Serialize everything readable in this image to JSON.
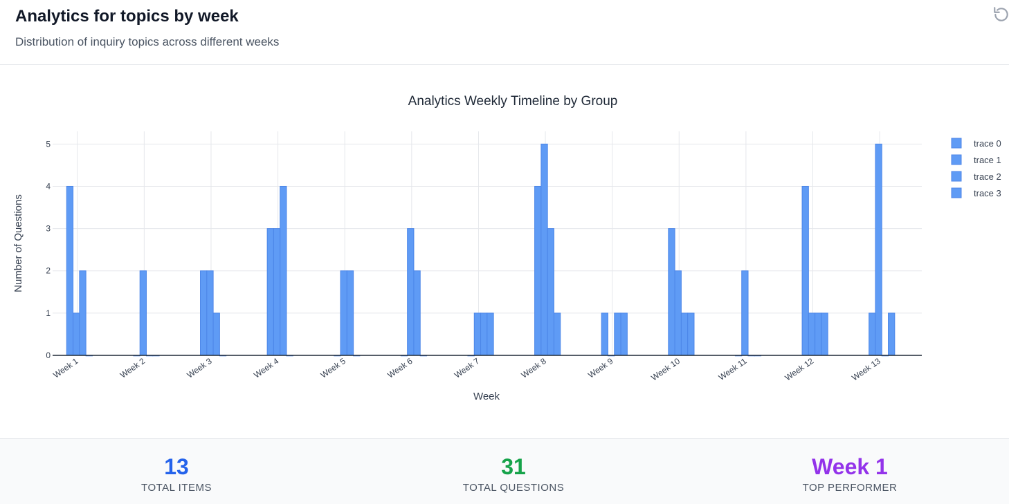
{
  "header": {
    "title": "Analytics for topics by week",
    "subtitle": "Distribution of inquiry topics across different weeks"
  },
  "chart_data": {
    "type": "bar",
    "title": "Analytics Weekly Timeline by Group",
    "xlabel": "Week",
    "ylabel": "Number of Questions",
    "categories": [
      "Week 1",
      "Week 2",
      "Week 3",
      "Week 4",
      "Week 5",
      "Week 6",
      "Week 7",
      "Week 8",
      "Week 9",
      "Week 10",
      "Week 11",
      "Week 12",
      "Week 13"
    ],
    "bar_slots_per_category": 7,
    "series": [
      {
        "name": "trace 0",
        "values": [
          4,
          0,
          2,
          3,
          0,
          0,
          0,
          4,
          1,
          3,
          0,
          4,
          1
        ]
      },
      {
        "name": "trace 1",
        "values": [
          1,
          2,
          2,
          3,
          2,
          3,
          1,
          5,
          0,
          2,
          2,
          1,
          5
        ]
      },
      {
        "name": "trace 2",
        "values": [
          2,
          0,
          1,
          4,
          2,
          2,
          1,
          3,
          1,
          1,
          0,
          1,
          0
        ]
      },
      {
        "name": "trace 3",
        "values": [
          0,
          0,
          0,
          0,
          0,
          0,
          1,
          1,
          1,
          1,
          0,
          1,
          1
        ]
      }
    ],
    "ylim": [
      0,
      5.3
    ],
    "yticks": [
      0,
      1,
      2,
      3,
      4,
      5
    ],
    "grid": true,
    "legend_position": "top-right",
    "bar_color": "#5f9bf5"
  },
  "stats": [
    {
      "value": "13",
      "label": "TOTAL ITEMS",
      "color": "#2563eb"
    },
    {
      "value": "31",
      "label": "TOTAL QUESTIONS",
      "color": "#16a34a"
    },
    {
      "value": "Week 1",
      "label": "TOP PERFORMER",
      "color": "#9333ea"
    }
  ],
  "icons": {
    "refresh": "refresh-icon"
  }
}
